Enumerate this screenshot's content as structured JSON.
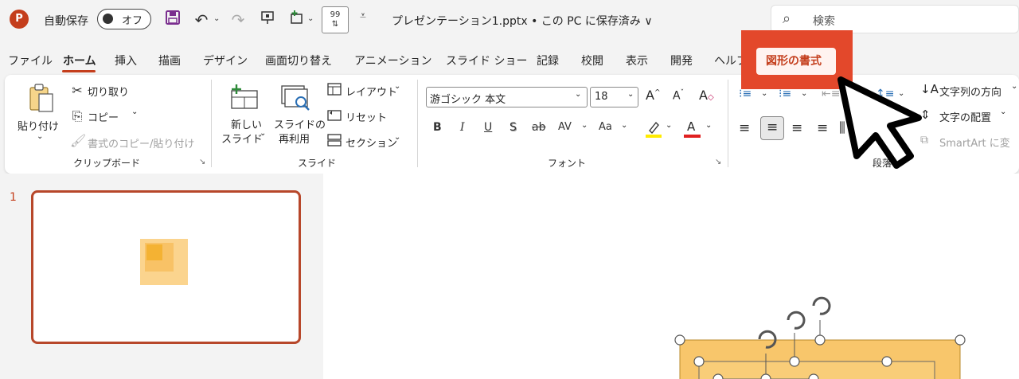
{
  "titlebar": {
    "app_logo": "P",
    "autosave_label": "自動保存",
    "autosave_state": "オフ",
    "filename": "プレゼンテーション1.pptx • この PC に保存済み ∨",
    "search_placeholder": "検索"
  },
  "tabs": [
    "ファイル",
    "ホーム",
    "挿入",
    "描画",
    "デザイン",
    "画面切り替え",
    "アニメーション",
    "スライド ショー",
    "記録",
    "校閲",
    "表示",
    "開発",
    "ヘルプ"
  ],
  "active_tab": "ホーム",
  "highlighted_tab": {
    "label": "図形の書式",
    "callout_color": "#e3482b"
  },
  "clipboard": {
    "paste": "貼り付け",
    "cut": "切り取り",
    "copy": "コピー",
    "format_painter": "書式のコピー/貼り付け",
    "label": "クリップボード"
  },
  "slides_group": {
    "new_slide_1": "新しい",
    "new_slide_2": "スライド",
    "reuse_1": "スライドの",
    "reuse_2": "再利用",
    "layout": "レイアウト",
    "reset": "リセット",
    "section": "セクション",
    "label": "スライド"
  },
  "font_group": {
    "font_name": "游ゴシック 本文",
    "font_size": "18",
    "bold": "B",
    "italic": "I",
    "underline": "U",
    "shadow": "S",
    "strike": "ab",
    "spacing": "AV",
    "case": "Aa",
    "label": "フォント"
  },
  "paragraph_group": {
    "text_direction": "文字列の方向",
    "align_text": "文字の配置",
    "smartart": "SmartArt に変",
    "label": "段落"
  },
  "slide_thumbnail": {
    "number": "1"
  },
  "colors": {
    "accent": "#c43e1c",
    "shape_fill": "#f8c66b",
    "shape_fill_light": "#fbd48e"
  }
}
